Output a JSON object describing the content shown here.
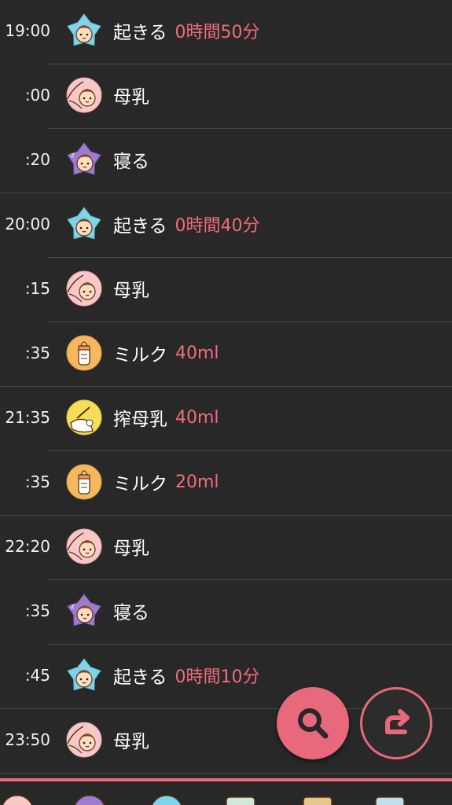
{
  "rows": [
    {
      "time": "19:00",
      "icon": "wake-icon",
      "label": "起きる",
      "detail": "0時間50分",
      "hour_end": false
    },
    {
      "time": ":00",
      "icon": "breastfeed-icon",
      "label": "母乳",
      "detail": "",
      "hour_end": false
    },
    {
      "time": ":20",
      "icon": "sleep-icon",
      "label": "寝る",
      "detail": "",
      "hour_end": true
    },
    {
      "time": "20:00",
      "icon": "wake-icon",
      "label": "起きる",
      "detail": "0時間40分",
      "hour_end": false
    },
    {
      "time": ":15",
      "icon": "breastfeed-icon",
      "label": "母乳",
      "detail": "",
      "hour_end": false
    },
    {
      "time": ":35",
      "icon": "milk-bottle-icon",
      "label": "ミルク",
      "detail": "40ml",
      "hour_end": true
    },
    {
      "time": "21:35",
      "icon": "pumped-milk-icon",
      "label": "搾母乳",
      "detail": "40ml",
      "hour_end": false
    },
    {
      "time": ":35",
      "icon": "milk-bottle-icon",
      "label": "ミルク",
      "detail": "20ml",
      "hour_end": true
    },
    {
      "time": "22:20",
      "icon": "breastfeed-icon",
      "label": "母乳",
      "detail": "",
      "hour_end": false
    },
    {
      "time": ":35",
      "icon": "sleep-icon",
      "label": "寝る",
      "detail": "",
      "hour_end": false
    },
    {
      "time": ":45",
      "icon": "wake-icon",
      "label": "起きる",
      "detail": "0時間10分",
      "hour_end": true
    },
    {
      "time": "23:50",
      "icon": "breastfeed-icon",
      "label": "母乳",
      "detail": "",
      "hour_end": true
    }
  ],
  "fabs": {
    "search_icon": "search-icon",
    "redo_icon": "redo-arrow-icon"
  },
  "bottom_tabs": [
    "breastfeed-tab",
    "sleep-tab",
    "wake-tab",
    "pumped-tab",
    "diaper-tab",
    "bath-tab"
  ],
  "colors": {
    "accent": "#e8687c",
    "background": "#282828",
    "divider": "#474747"
  }
}
